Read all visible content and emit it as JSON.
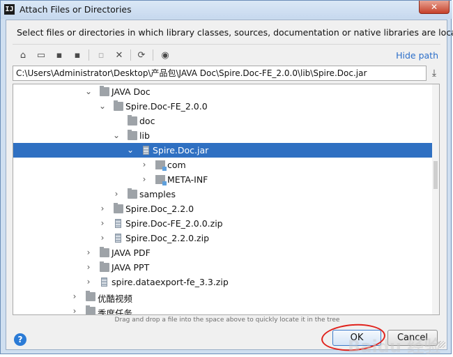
{
  "window": {
    "title": "Attach Files or Directories",
    "close_label": "✕"
  },
  "description": "Select files or directories in which library classes, sources, documentation or native libraries are located",
  "toolbar": {
    "hide_path_label": "Hide path",
    "buttons": [
      "home",
      "desktop",
      "project",
      "module",
      "new-folder",
      "delete",
      "refresh",
      "show-hidden"
    ]
  },
  "path": {
    "value": "C:\\Users\\Administrator\\Desktop\\产品包\\JAVA Doc\\Spire.Doc-FE_2.0.0\\lib\\Spire.Doc.jar"
  },
  "tree": {
    "rows": [
      {
        "label": "JAVA Doc",
        "type": "folder",
        "expanded": true
      },
      {
        "label": "Spire.Doc-FE_2.0.0",
        "type": "folder",
        "expanded": true
      },
      {
        "label": "doc",
        "type": "folder",
        "expanded": false,
        "leaf": true
      },
      {
        "label": "lib",
        "type": "folder",
        "expanded": true
      },
      {
        "label": "Spire.Doc.jar",
        "type": "jar",
        "expanded": true,
        "selected": true
      },
      {
        "label": "com",
        "type": "package",
        "expanded": false
      },
      {
        "label": "META-INF",
        "type": "package",
        "expanded": false
      },
      {
        "label": "samples",
        "type": "folder",
        "expanded": false
      },
      {
        "label": "Spire.Doc_2.2.0",
        "type": "folder",
        "expanded": false
      },
      {
        "label": "Spire.Doc-FE_2.0.0.zip",
        "type": "jar",
        "expanded": false
      },
      {
        "label": "Spire.Doc_2.2.0.zip",
        "type": "jar",
        "expanded": false
      },
      {
        "label": "JAVA PDF",
        "type": "folder",
        "expanded": false
      },
      {
        "label": "JAVA PPT",
        "type": "folder",
        "expanded": false
      },
      {
        "label": "spire.dataexport-fe_3.3.zip",
        "type": "jar",
        "expanded": false
      },
      {
        "label": "优酷视频",
        "type": "folder",
        "expanded": false
      },
      {
        "label": "季度任务",
        "type": "folder",
        "expanded": false
      }
    ]
  },
  "hint": "Drag and drop a file into the space above to quickly locate it in the tree",
  "buttons": {
    "help": "?",
    "ok": "OK",
    "cancel": "Cancel"
  },
  "watermark": "Baidu 经验",
  "colors": {
    "selection": "#2f70c2",
    "link": "#2b6ec9",
    "annotation": "#e0211b"
  }
}
